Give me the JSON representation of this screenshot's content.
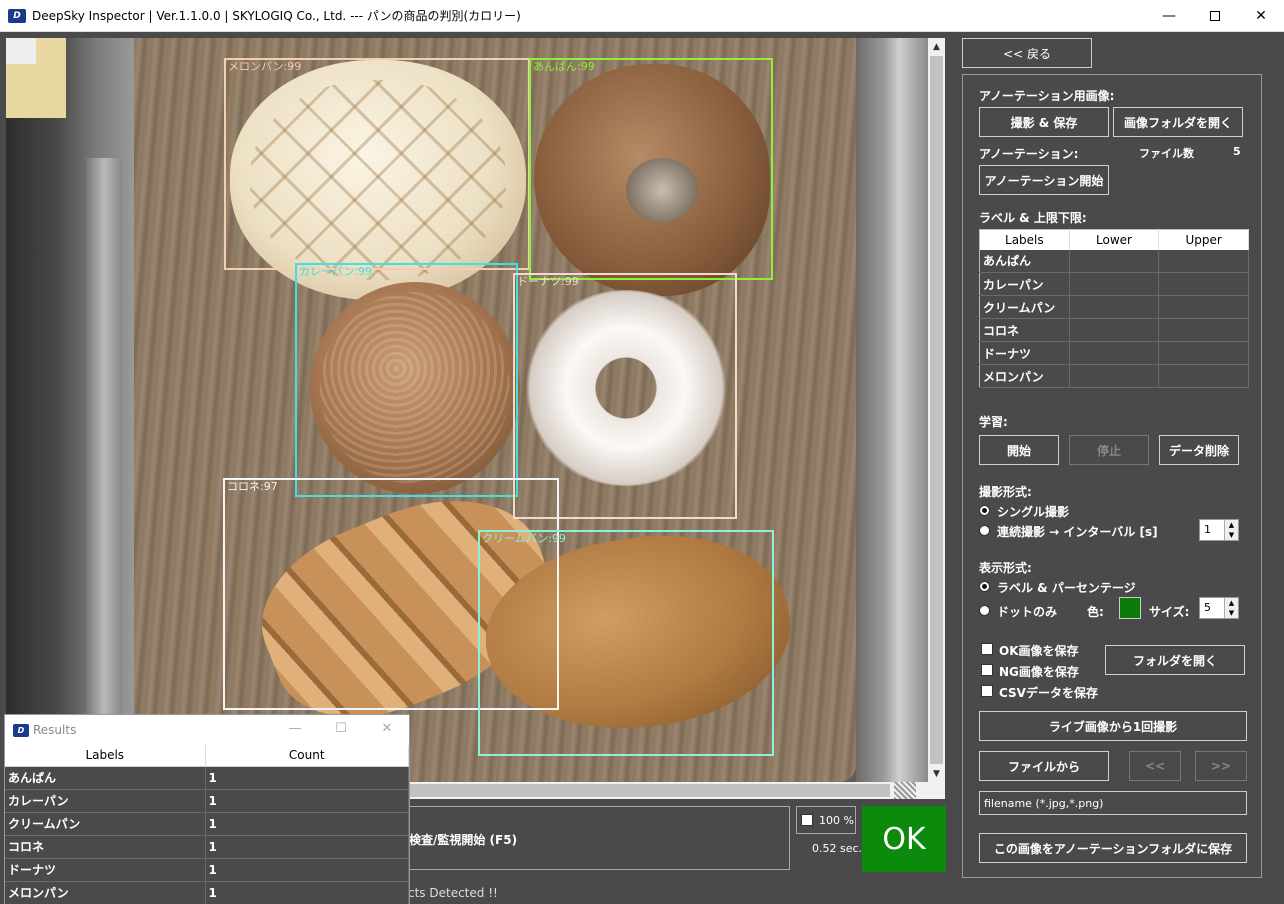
{
  "window": {
    "title": "DeepSky Inspector | Ver.1.1.0.0 | SKYLOGIQ Co., Ltd. --- パンの商品の判別(カロリー)",
    "icon_name": "app-logo-icon",
    "minimize": "—",
    "close": "✕"
  },
  "detections": [
    {
      "label": "メロンパン:99",
      "color": "#f2cfb0"
    },
    {
      "label": "あんぱん:99",
      "color": "#8ef03a"
    },
    {
      "label": "カレーパン:99",
      "color": "#3fe0e0"
    },
    {
      "label": "ドーナツ:99",
      "color": "#f0dccc"
    },
    {
      "label": "コロネ:97",
      "color": "#f4f4f4"
    },
    {
      "label": "クリームパン:99",
      "color": "#8ff0d8"
    }
  ],
  "scrollbar": {
    "up": "▲",
    "down": "▼"
  },
  "bottom": {
    "inspect_label": "検査/監視開始 (F5)",
    "zoom_label": "100 %",
    "time": "0.52 sec.",
    "result": "OK",
    "status": "cts Detected !!"
  },
  "results_window": {
    "title": "Results",
    "minimize": "—",
    "maximize": "☐",
    "close": "✕",
    "headers": [
      "Labels",
      "Count"
    ],
    "rows": [
      {
        "label": "あんぱん",
        "count": "1"
      },
      {
        "label": "カレーパン",
        "count": "1"
      },
      {
        "label": "クリームパン",
        "count": "1"
      },
      {
        "label": "コロネ",
        "count": "1"
      },
      {
        "label": "ドーナツ",
        "count": "1"
      },
      {
        "label": "メロンパン",
        "count": "1"
      }
    ]
  },
  "panel": {
    "back": "<< 戻る",
    "annotation_image": "アノーテーション用画像:",
    "capture_save": "撮影 & 保存",
    "open_image_folder": "画像フォルダを開く",
    "annotation": "アノーテーション:",
    "file_count_label": "ファイル数",
    "file_count": "5",
    "start_annotation": "アノーテーション開始",
    "labels_limits": "ラベル & 上限下限:",
    "label_headers": [
      "Labels",
      "Lower",
      "Upper"
    ],
    "labels": [
      "あんぱん",
      "カレーパン",
      "クリームパン",
      "コロネ",
      "ドーナツ",
      "メロンパン"
    ],
    "learning": "学習:",
    "start": "開始",
    "stop": "停止",
    "delete_data": "データ削除",
    "capture_mode": "撮影形式:",
    "single": "シングル撮影",
    "continuous": "連続撮影 → インターバル [s]",
    "interval": "1",
    "display_mode": "表示形式:",
    "label_percent": "ラベル & パーセンテージ",
    "dot_only": "ドットのみ",
    "color_label": "色:",
    "dot_color": "#0b7a0b",
    "size_label": "サイズ:",
    "size": "5",
    "save_ok": "OK画像を保存",
    "save_ng": "NG画像を保存",
    "save_csv": "CSVデータを保存",
    "open_folder": "フォルダを開く",
    "capture_live": "ライブ画像から1回撮影",
    "from_file": "ファイルから",
    "prev": "<<",
    "next": ">>",
    "filename_placeholder": "filename (*.jpg,*.png)",
    "save_to_annotation": "この画像をアノーテーションフォルダに保存"
  }
}
